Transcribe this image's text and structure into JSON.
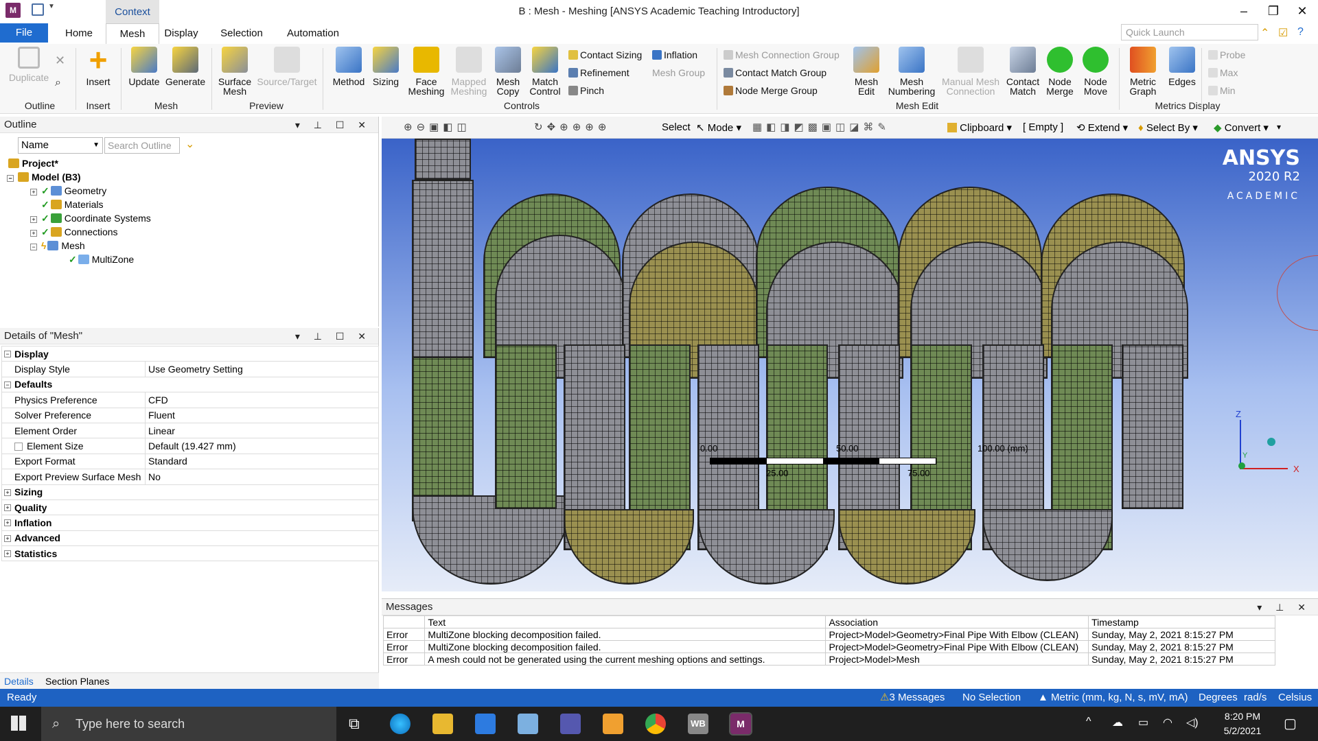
{
  "titlebar": {
    "app_icon": "M",
    "context_tab": "Context",
    "title": "B : Mesh - Meshing [ANSYS Academic Teaching Introductory]",
    "minimize": "–",
    "restore": "❐",
    "close": "✕"
  },
  "tabs": {
    "file": "File",
    "home": "Home",
    "mesh": "Mesh",
    "display": "Display",
    "selection": "Selection",
    "automation": "Automation"
  },
  "quick_launch_placeholder": "Quick Launch",
  "ribbon": {
    "duplicate": "Duplicate",
    "outline_group": "Outline",
    "insert": "Insert",
    "insert_group": "Insert",
    "update": "Update",
    "generate": "Generate",
    "mesh_group": "Mesh",
    "surface_mesh_1": "Surface",
    "surface_mesh_2": "Mesh",
    "source_target": "Source/Target",
    "preview_group": "Preview",
    "method": "Method",
    "sizing": "Sizing",
    "face_meshing_1": "Face",
    "face_meshing_2": "Meshing",
    "mapped_meshing_1": "Mapped",
    "mapped_meshing_2": "Meshing",
    "mesh_copy_1": "Mesh",
    "mesh_copy_2": "Copy",
    "match_control_1": "Match",
    "match_control_2": "Control",
    "controls_group": "Controls",
    "contact_sizing": "Contact Sizing",
    "refinement": "Refinement",
    "pinch": "Pinch",
    "inflation": "Inflation",
    "mesh_group_btn": "Mesh Group",
    "mesh_connection_group": "Mesh Connection Group",
    "contact_match_group": "Contact Match Group",
    "node_merge_group": "Node Merge Group",
    "mesh_edit_1": "Mesh",
    "mesh_edit_2": "Edit",
    "mesh_numbering_1": "Mesh",
    "mesh_numbering_2": "Numbering",
    "manual_mesh_1": "Manual Mesh",
    "manual_mesh_2": "Connection",
    "contact_match_1": "Contact",
    "contact_match_2": "Match",
    "node_merge_1": "Node",
    "node_merge_2": "Merge",
    "node_move_1": "Node",
    "node_move_2": "Move",
    "mesh_edit_group": "Mesh Edit",
    "metric_graph_1": "Metric",
    "metric_graph_2": "Graph",
    "edges": "Edges",
    "metrics_display_group": "Metrics Display",
    "probe": "Probe",
    "max": "Max",
    "min": "Min"
  },
  "outline": {
    "header": "Outline",
    "name_filter": "Name",
    "search_placeholder": "Search Outline",
    "tree": {
      "project": "Project*",
      "model": "Model (B3)",
      "geometry": "Geometry",
      "materials": "Materials",
      "coordinate_systems": "Coordinate Systems",
      "connections": "Connections",
      "mesh": "Mesh",
      "multizone": "MultiZone"
    }
  },
  "details": {
    "header": "Details of \"Mesh\"",
    "display_cat": "Display",
    "display_style_k": "Display Style",
    "display_style_v": "Use Geometry Setting",
    "defaults_cat": "Defaults",
    "physics_pref_k": "Physics Preference",
    "physics_pref_v": "CFD",
    "solver_pref_k": "Solver Preference",
    "solver_pref_v": "Fluent",
    "element_order_k": "Element Order",
    "element_order_v": "Linear",
    "element_size_k": "Element Size",
    "element_size_v": "Default (19.427 mm)",
    "export_format_k": "Export Format",
    "export_format_v": "Standard",
    "export_preview_k": "Export Preview Surface Mesh",
    "export_preview_v": "No",
    "sizing_cat": "Sizing",
    "quality_cat": "Quality",
    "inflation_cat": "Inflation",
    "advanced_cat": "Advanced",
    "statistics_cat": "Statistics"
  },
  "bottom_tabs": {
    "details": "Details",
    "section_planes": "Section Planes"
  },
  "viewport_toolbar": {
    "select": "Select",
    "mode": "Mode",
    "clipboard": "Clipboard",
    "empty": "[ Empty ]",
    "extend": "Extend",
    "select_by": "Select By",
    "convert": "Convert"
  },
  "viewport": {
    "logo_line1": "ANSYS",
    "logo_line2": "2020 R2",
    "logo_line3": "ACADEMIC",
    "scale_0": "0.00",
    "scale_50": "50.00",
    "scale_100": "100.00 (mm)",
    "scale_25": "25.00",
    "scale_75": "75.00",
    "axis_z": "Z",
    "axis_y": "Y",
    "axis_x": "X"
  },
  "messages": {
    "header": "Messages",
    "columns": [
      "Text",
      "Association",
      "Timestamp"
    ],
    "rows": [
      {
        "type": "Error",
        "text": "MultiZone blocking decomposition failed.",
        "assoc": "Project>Model>Geometry>Final Pipe With Elbow (CLEAN)",
        "time": "Sunday, May 2, 2021 8:15:27 PM"
      },
      {
        "type": "Error",
        "text": "MultiZone blocking decomposition failed.",
        "assoc": "Project>Model>Geometry>Final Pipe With Elbow (CLEAN)",
        "time": "Sunday, May 2, 2021 8:15:27 PM"
      },
      {
        "type": "Error",
        "text": "A mesh could not be generated using the current meshing options and settings.",
        "assoc": "Project>Model>Mesh",
        "time": "Sunday, May 2, 2021 8:15:27 PM"
      }
    ]
  },
  "statusbar": {
    "ready": "Ready",
    "messages": "3 Messages",
    "selection": "No Selection",
    "units": "Metric (mm, kg, N, s, mV, mA)",
    "degrees": "Degrees",
    "rads": "rad/s",
    "temp": "Celsius"
  },
  "taskbar": {
    "search_placeholder": "Type here to search",
    "time": "8:20 PM",
    "date": "5/2/2021",
    "wb_label": "WB",
    "m_label": "M"
  },
  "colors": {
    "file_tab": "#1f6ccf",
    "statusbar": "#1e62c2",
    "mesh_green": "#6f8a55",
    "mesh_grey": "#8e8f96",
    "mesh_yellow": "#9a9050"
  }
}
